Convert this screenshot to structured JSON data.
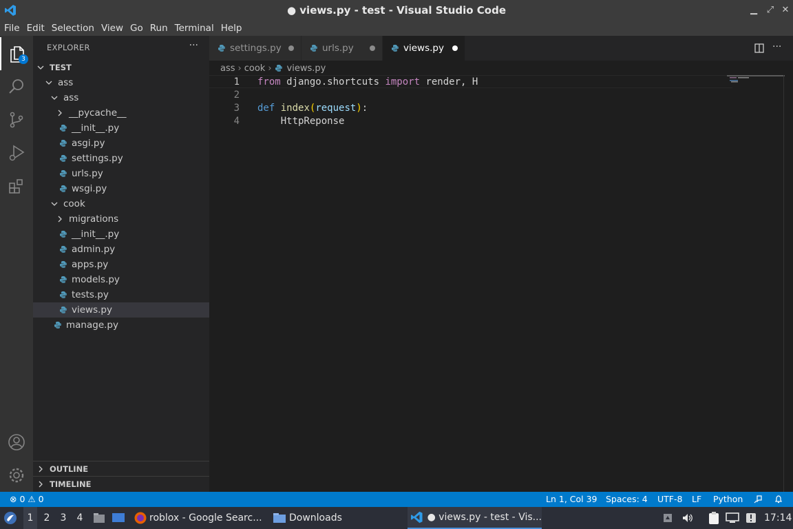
{
  "window": {
    "title": "● views.py - test - Visual Studio Code"
  },
  "menu": [
    "File",
    "Edit",
    "Selection",
    "View",
    "Go",
    "Run",
    "Terminal",
    "Help"
  ],
  "activity": {
    "explorer_badge": "3"
  },
  "sidebar": {
    "header": "EXPLORER",
    "more": "···",
    "tree": [
      {
        "label": "TEST",
        "type": "root",
        "expanded": true
      },
      {
        "label": "ass",
        "type": "folder",
        "expanded": true
      },
      {
        "label": "ass",
        "type": "folder",
        "expanded": true
      },
      {
        "label": "__pycache__",
        "type": "folder",
        "expanded": false
      },
      {
        "label": "__init__.py",
        "type": "file"
      },
      {
        "label": "asgi.py",
        "type": "file"
      },
      {
        "label": "settings.py",
        "type": "file"
      },
      {
        "label": "urls.py",
        "type": "file"
      },
      {
        "label": "wsgi.py",
        "type": "file"
      },
      {
        "label": "cook",
        "type": "folder",
        "expanded": true
      },
      {
        "label": "migrations",
        "type": "folder",
        "expanded": false
      },
      {
        "label": "__init__.py",
        "type": "file"
      },
      {
        "label": "admin.py",
        "type": "file"
      },
      {
        "label": "apps.py",
        "type": "file"
      },
      {
        "label": "models.py",
        "type": "file"
      },
      {
        "label": "tests.py",
        "type": "file"
      },
      {
        "label": "views.py",
        "type": "file",
        "selected": true
      },
      {
        "label": "manage.py",
        "type": "file"
      }
    ],
    "outline": "OUTLINE",
    "timeline": "TIMELINE"
  },
  "tabs": [
    {
      "label": "settings.py",
      "modified": true,
      "active": false
    },
    {
      "label": "urls.py",
      "modified": true,
      "active": false
    },
    {
      "label": "views.py",
      "modified": true,
      "active": true
    }
  ],
  "breadcrumb": [
    "ass",
    "cook",
    "views.py"
  ],
  "editor": {
    "line_numbers": [
      "1",
      "2",
      "3",
      "4"
    ],
    "line1": {
      "kw1": "from",
      "mod": " django.shortcuts ",
      "kw2": "import",
      "rest": " render, H"
    },
    "line3": {
      "def": "def",
      "fn": " index",
      "open": "(",
      "param": "request",
      "close": ")",
      "colon": ":"
    },
    "line4": {
      "text": "    HttpReponse"
    }
  },
  "status": {
    "errors": "0",
    "warnings": "0",
    "position": "Ln 1, Col 39",
    "spaces": "Spaces: 4",
    "encoding": "UTF-8",
    "eol": "LF",
    "language": "Python"
  },
  "taskbar": {
    "workspaces": [
      "1",
      "2",
      "3",
      "4"
    ],
    "windows": [
      "roblox - Google Searc...",
      "Downloads",
      "● views.py - test - Vis..."
    ],
    "clock": "17:14"
  },
  "colors": {
    "accent": "#007acc",
    "python_icon": "#519aba",
    "taskbar": "#2b2e37"
  }
}
